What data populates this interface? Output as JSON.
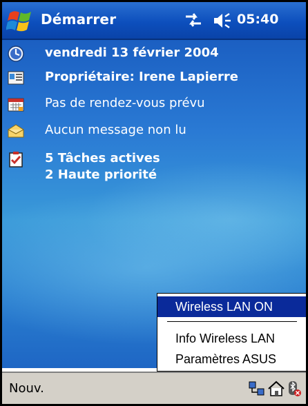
{
  "titlebar": {
    "start_label": "Démarrer",
    "time": "05:40",
    "icons": [
      "windows-flag-icon",
      "connectivity-icon",
      "volume-icon"
    ]
  },
  "today": {
    "date": "vendredi 13 février 2004",
    "owner": "Propriétaire: Irene Lapierre",
    "appointments": "Pas de rendez-vous prévu",
    "messages": "Aucun message non lu",
    "tasks_line1": "5 Tâches actives",
    "tasks_line2": "2 Haute priorité"
  },
  "menu": {
    "items": [
      "Wireless LAN ON",
      "Info Wireless LAN",
      "Paramètres ASUS"
    ],
    "selected": "Wireless LAN ON"
  },
  "bottombar": {
    "left_label": "Nouv.",
    "icons": [
      "network-icon",
      "home-icon",
      "bluetooth-icon"
    ]
  },
  "colors": {
    "titlebar": "#0d4fbd",
    "menu_highlight": "#0a2a9a",
    "bottombar": "#d4d0c8"
  }
}
